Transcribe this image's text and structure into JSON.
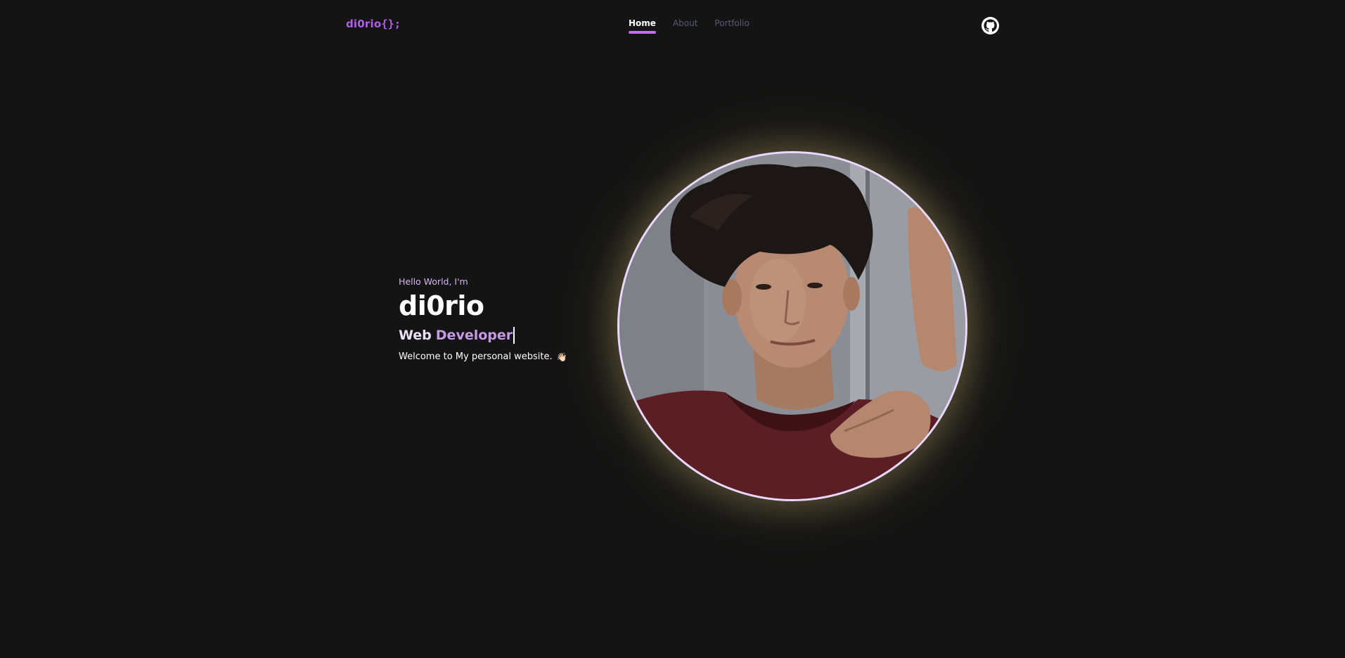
{
  "nav": {
    "logo_text": "di0rio",
    "logo_suffix": "{};",
    "items": [
      {
        "label": "Home",
        "active": true
      },
      {
        "label": "About",
        "active": false
      },
      {
        "label": "Portfolio",
        "active": false
      }
    ],
    "github_icon": "github-icon"
  },
  "hero": {
    "greeting": "Hello World, I'm",
    "name": "di0rio",
    "role_prefix": "Web",
    "role_typed": "Developer",
    "welcome": "Welcome to My personal website.",
    "wave_emoji": "👋🏻"
  },
  "colors": {
    "background": "#141414",
    "accent": "#b05fe6",
    "nav_active_underline": "#c46cf0",
    "nav_inactive": "#565b75",
    "greeting": "#d6b3f5",
    "role_typed": "#c59ae8",
    "portrait_border": "#ead8ff"
  }
}
